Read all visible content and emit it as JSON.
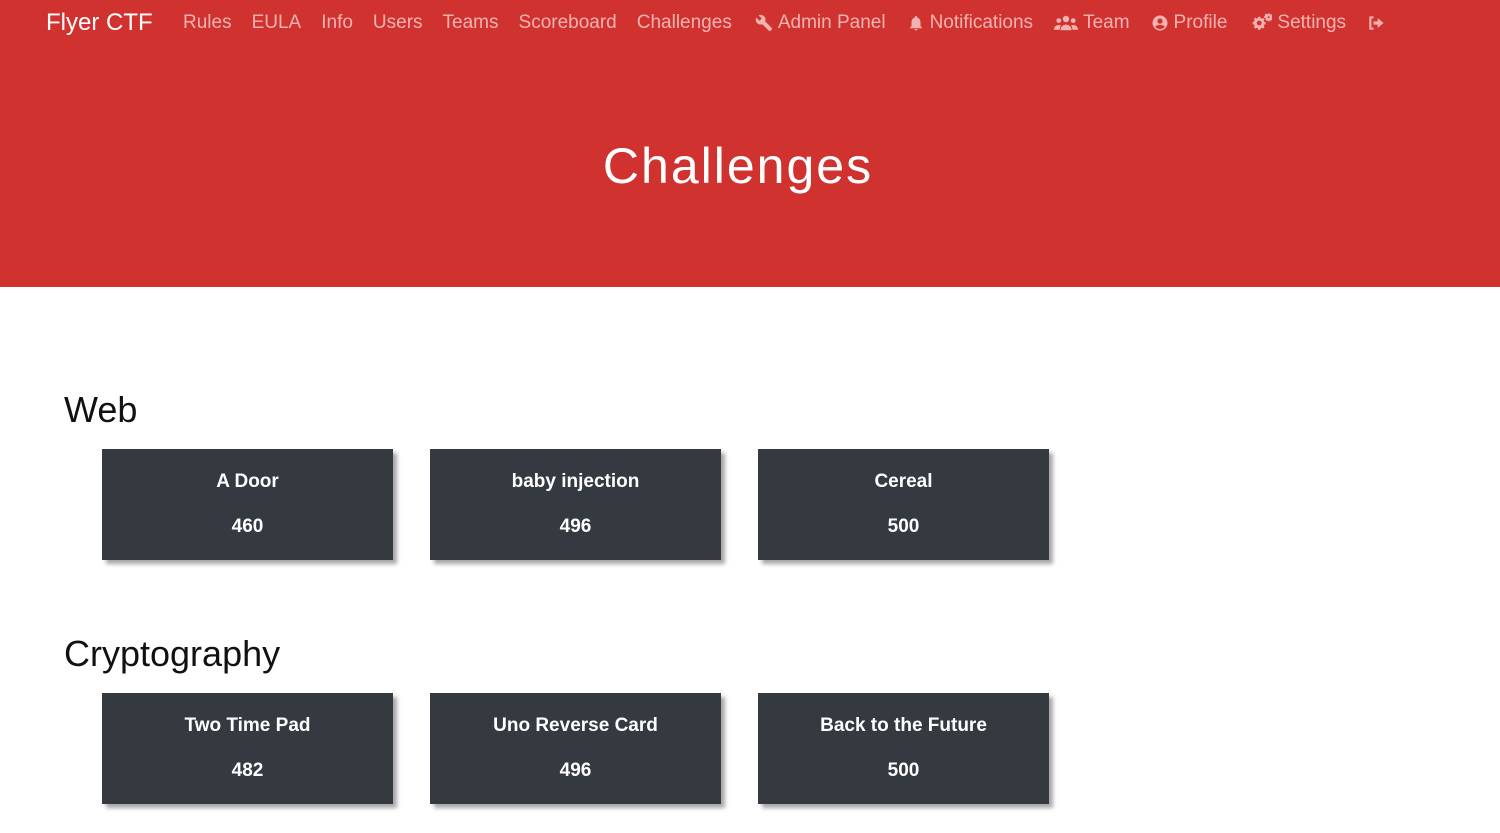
{
  "navbar": {
    "brand": "Flyer CTF",
    "links": [
      "Rules",
      "EULA",
      "Info",
      "Users",
      "Teams",
      "Scoreboard",
      "Challenges"
    ],
    "admin_panel": "Admin Panel",
    "notifications": "Notifications",
    "team": "Team",
    "profile": "Profile",
    "settings": "Settings"
  },
  "hero": {
    "title": "Challenges"
  },
  "categories": [
    {
      "name": "Web",
      "challenges": [
        {
          "name": "A Door",
          "points": "460"
        },
        {
          "name": "baby injection",
          "points": "496"
        },
        {
          "name": "Cereal",
          "points": "500"
        }
      ]
    },
    {
      "name": "Cryptography",
      "challenges": [
        {
          "name": "Two Time Pad",
          "points": "482"
        },
        {
          "name": "Uno Reverse Card",
          "points": "496"
        },
        {
          "name": "Back to the Future",
          "points": "500"
        }
      ]
    }
  ],
  "colors": {
    "header_bg": "#d03230",
    "nav_link": "#f2b3b0",
    "card_bg": "#343a40"
  }
}
